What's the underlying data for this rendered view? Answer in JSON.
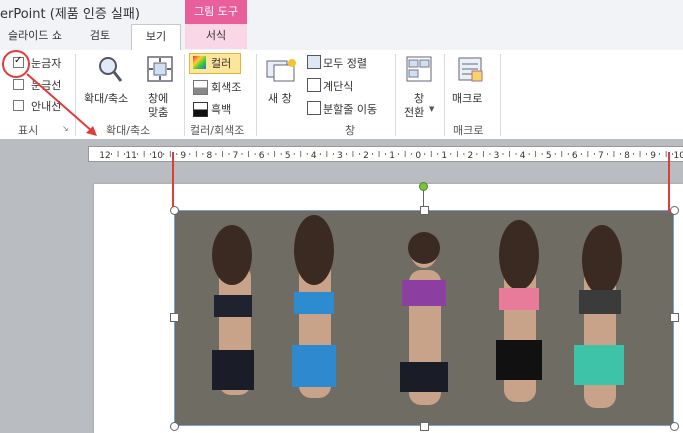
{
  "window": {
    "title": "erPoint (제품 인증 실패)"
  },
  "contextual_tab_header": "그림 도구",
  "tabs": [
    {
      "label": "슬라이드 쇼"
    },
    {
      "label": "검토"
    },
    {
      "label": "보기"
    },
    {
      "label": "서식"
    }
  ],
  "ribbon": {
    "show_group": {
      "label": "표시",
      "items": [
        {
          "label": "눈금자",
          "checked": true
        },
        {
          "label": "눈금선",
          "checked": false
        },
        {
          "label": "안내선",
          "checked": false
        }
      ]
    },
    "zoom_group": {
      "label": "확대/축소",
      "zoom_label": "확대/축소",
      "fit_label_line1": "창에",
      "fit_label_line2": "맞춤"
    },
    "color_group": {
      "label": "컬러/회색조",
      "items": [
        {
          "label": "컬러"
        },
        {
          "label": "회색조"
        },
        {
          "label": "흑백"
        }
      ]
    },
    "window_group": {
      "label": "창",
      "new_window": "새 창",
      "arrange_all": "모두 정렬",
      "cascade": "계단식",
      "move_split": "분할줄 이동",
      "switch_line1": "창",
      "switch_line2": "전환"
    },
    "macro_group": {
      "label": "매크로",
      "macro": "매크로"
    }
  },
  "ruler": {
    "labels": [
      "12",
      "11",
      "10",
      "9",
      "8",
      "7",
      "6",
      "5",
      "4",
      "3",
      "2",
      "1",
      "0",
      "1",
      "2",
      "3",
      "4",
      "5",
      "6",
      "7",
      "8",
      "9",
      "10"
    ]
  },
  "colors": {
    "accent_red": "#e23b3b",
    "context_pink": "#e85f9c",
    "handle_green": "#7ac142"
  }
}
